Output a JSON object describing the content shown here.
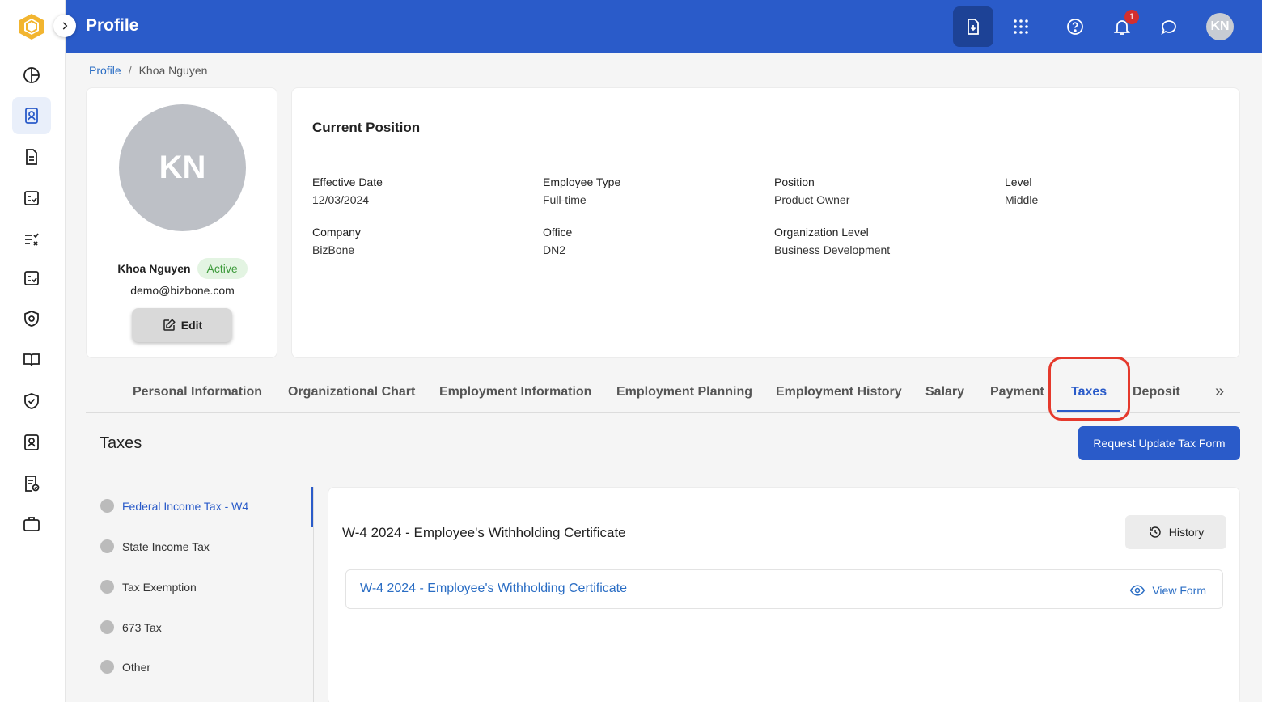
{
  "header": {
    "title": "Profile",
    "notification_count": "1",
    "user_initials": "KN"
  },
  "breadcrumb": {
    "root": "Profile",
    "current": "Khoa Nguyen"
  },
  "profile": {
    "initials": "KN",
    "name": "Khoa Nguyen",
    "status": "Active",
    "email": "demo@bizbone.com",
    "edit_label": "Edit"
  },
  "position": {
    "title": "Current Position",
    "fields": [
      {
        "label": "Effective Date",
        "value": "12/03/2024"
      },
      {
        "label": "Employee Type",
        "value": "Full-time"
      },
      {
        "label": "Position",
        "value": "Product Owner"
      },
      {
        "label": "Level",
        "value": "Middle"
      },
      {
        "label": "Company",
        "value": "BizBone"
      },
      {
        "label": "Office",
        "value": "DN2"
      },
      {
        "label": "Organization Level",
        "value": "Business Development"
      }
    ]
  },
  "tabs": [
    {
      "label": "Personal Information"
    },
    {
      "label": "Organizational Chart"
    },
    {
      "label": "Employment Information"
    },
    {
      "label": "Employment Planning"
    },
    {
      "label": "Employment History"
    },
    {
      "label": "Salary"
    },
    {
      "label": "Payment"
    },
    {
      "label": "Taxes"
    },
    {
      "label": "Deposit"
    }
  ],
  "tabs_more": "»",
  "taxes": {
    "title": "Taxes",
    "request_button": "Request Update Tax Form",
    "side_items": [
      {
        "label": "Federal Income Tax - W4"
      },
      {
        "label": "State Income Tax"
      },
      {
        "label": "Tax Exemption"
      },
      {
        "label": "673 Tax"
      },
      {
        "label": "Other"
      }
    ],
    "form_title": "W-4 2024 - Employee's Withholding Certificate",
    "history_button": "History",
    "form_link": "W-4 2024 - Employee's Withholding Certificate",
    "view_form": "View Form"
  },
  "colors": {
    "brand": "#2a5bc9",
    "link": "#2a6dc4",
    "status_bg": "#e3f4e2",
    "status_text": "#3c9a3a",
    "highlight": "#e5392c"
  }
}
